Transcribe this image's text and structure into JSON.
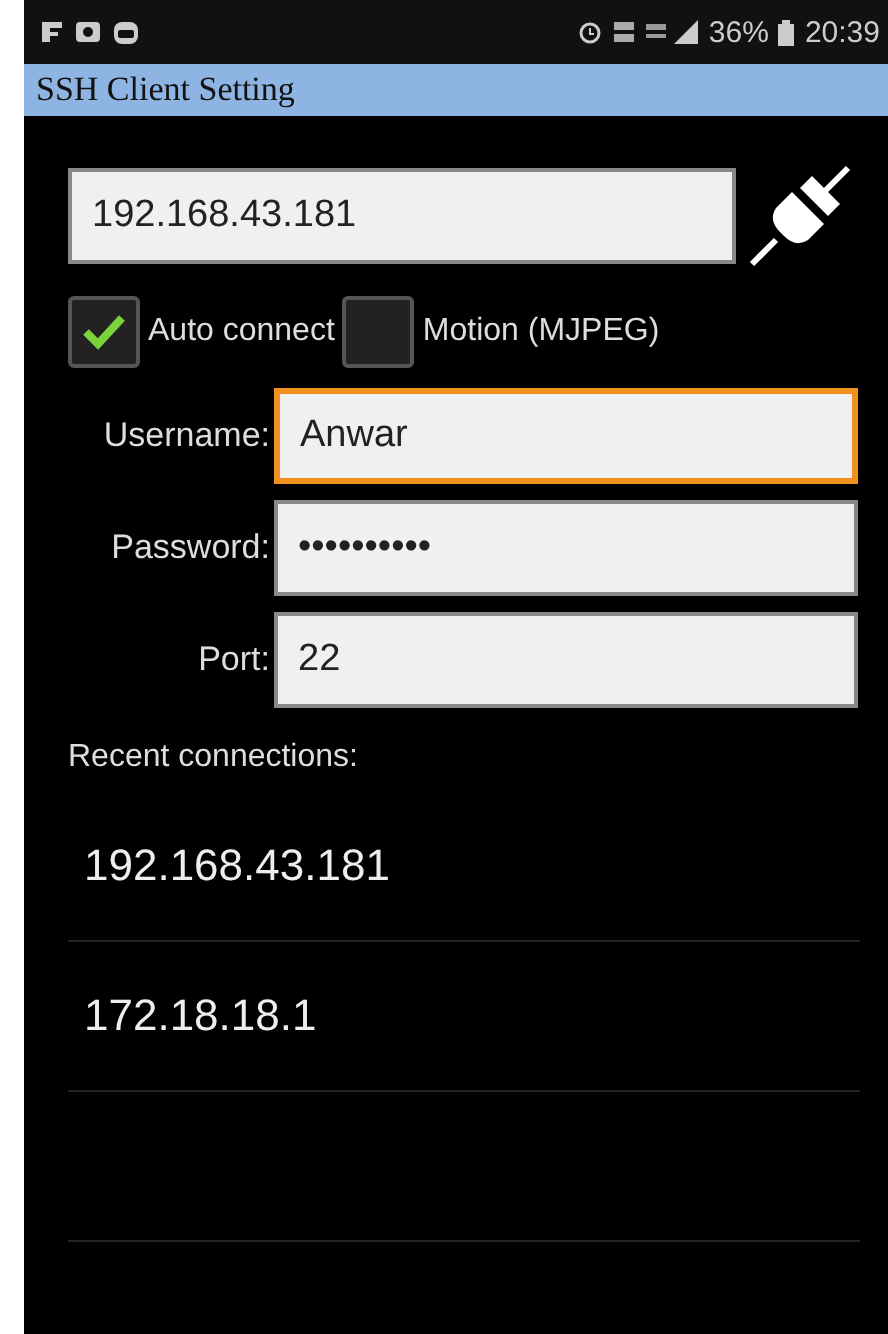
{
  "status_bar": {
    "battery": "36%",
    "time": "20:39"
  },
  "window": {
    "title": "SSH Client Setting"
  },
  "host": {
    "value": "192.168.43.181"
  },
  "options": [
    {
      "label": "Auto connect",
      "checked": true
    },
    {
      "label": "Motion (MJPEG)",
      "checked": false
    }
  ],
  "fields": [
    {
      "label": "Username:",
      "value": "Anwar",
      "focused": true
    },
    {
      "label": "Password:",
      "value": "••••••••••",
      "focused": false
    },
    {
      "label": "Port:",
      "value": "22",
      "focused": false
    }
  ],
  "recent": {
    "heading": "Recent connections:",
    "items": [
      "192.168.43.181",
      "172.18.18.1"
    ]
  }
}
